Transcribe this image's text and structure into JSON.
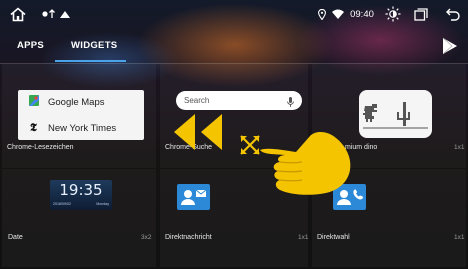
{
  "statusbar": {
    "time": "09:40",
    "icons": [
      "home-icon",
      "notification-icons",
      "location-icon",
      "wifi-icon",
      "brightness-icon",
      "recent-apps-icon",
      "back-icon"
    ]
  },
  "tabs": {
    "apps_label": "APPS",
    "widgets_label": "WIDGETS",
    "active": "WIDGETS"
  },
  "widgets": [
    {
      "label": "Chrome-Lesezeichen",
      "size": "",
      "bookmarks": [
        "Google Maps",
        "New York Times"
      ]
    },
    {
      "label": "Chrome-Suche",
      "size": "",
      "search_placeholder": "Search"
    },
    {
      "label": "mium dino",
      "size": "1x1"
    },
    {
      "label": "Date",
      "size": "3x2",
      "clock_time": "19:35",
      "clock_date": "2018/09/02",
      "clock_day": "Monday"
    },
    {
      "label": "Direktnachricht",
      "size": "1x1"
    },
    {
      "label": "Direktwahl",
      "size": "1x1"
    }
  ],
  "colors": {
    "accent": "#4aa3e8",
    "gesture_yellow": "#f5c400",
    "contact_blue": "#2c89d8"
  }
}
